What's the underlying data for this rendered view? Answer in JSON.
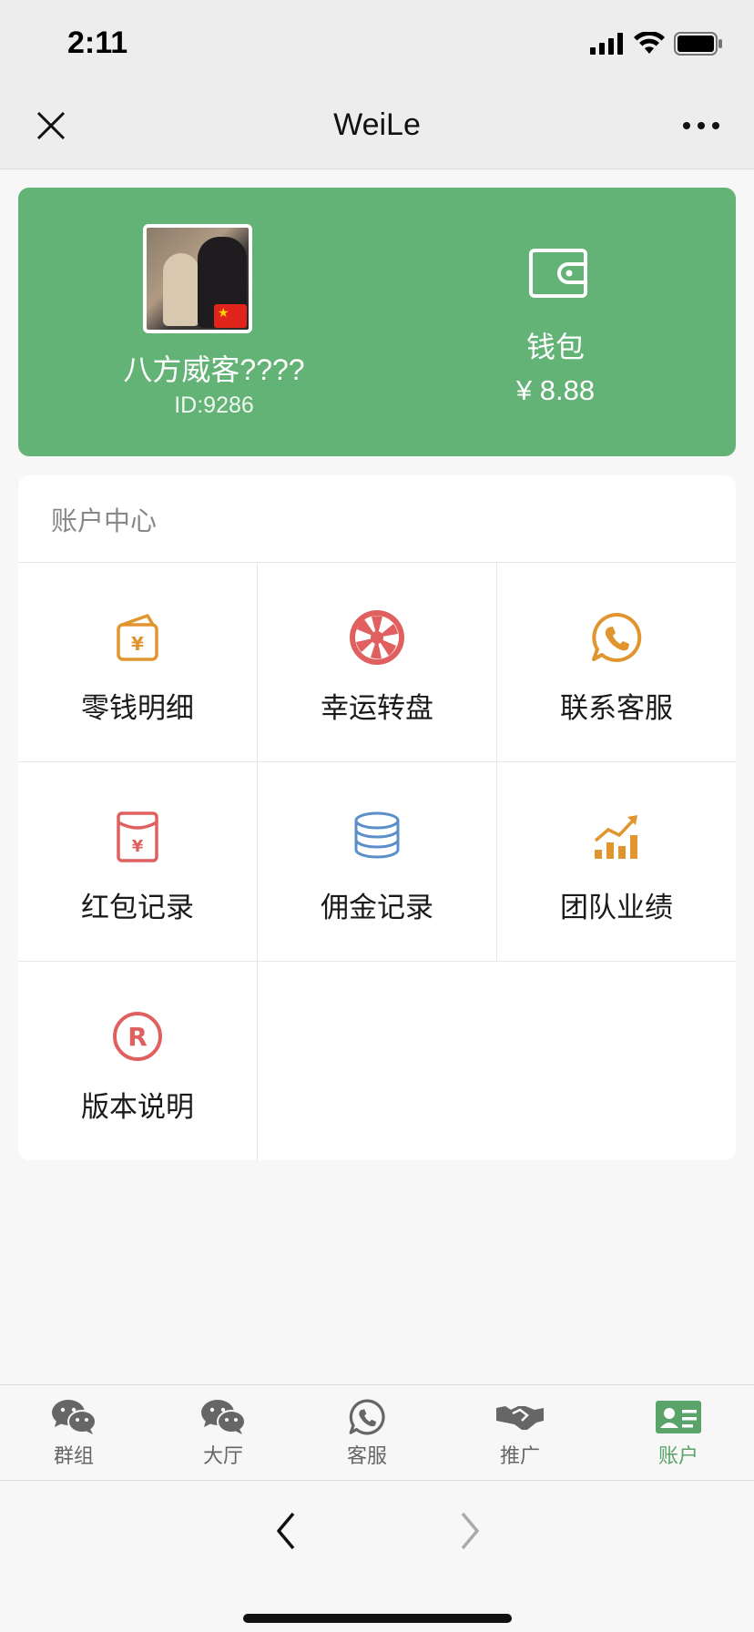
{
  "status_bar": {
    "time": "2:11"
  },
  "nav": {
    "title": "WeiLe",
    "close_icon": "close-icon",
    "more_icon": "more-dots-icon"
  },
  "profile": {
    "name": "八方威客????",
    "id_text": "ID:9286",
    "wallet_label": "钱包",
    "wallet_amount": "¥ 8.88",
    "card_color": "#63b276"
  },
  "account_center": {
    "title": "账户中心",
    "items": [
      {
        "label": "零钱明细",
        "icon": "wallet-yuan-icon",
        "color": "#e0952f"
      },
      {
        "label": "幸运转盘",
        "icon": "lucky-wheel-icon",
        "color": "#e06060"
      },
      {
        "label": "联系客服",
        "icon": "phone-chat-icon",
        "color": "#e0952f"
      },
      {
        "label": "红包记录",
        "icon": "red-envelope-icon",
        "color": "#e06060"
      },
      {
        "label": "佣金记录",
        "icon": "coin-stack-icon",
        "color": "#5b8fc9"
      },
      {
        "label": "团队业绩",
        "icon": "growth-chart-icon",
        "color": "#e0952f"
      },
      {
        "label": "版本说明",
        "icon": "registered-icon",
        "color": "#e06060"
      }
    ]
  },
  "tabs": [
    {
      "label": "群组",
      "icon": "wechat-icon",
      "active": false
    },
    {
      "label": "大厅",
      "icon": "wechat-icon",
      "active": false
    },
    {
      "label": "客服",
      "icon": "phone-chat-icon",
      "active": false
    },
    {
      "label": "推广",
      "icon": "handshake-icon",
      "active": false
    },
    {
      "label": "账户",
      "icon": "id-card-icon",
      "active": true
    }
  ],
  "accent_color": "#5aa469"
}
